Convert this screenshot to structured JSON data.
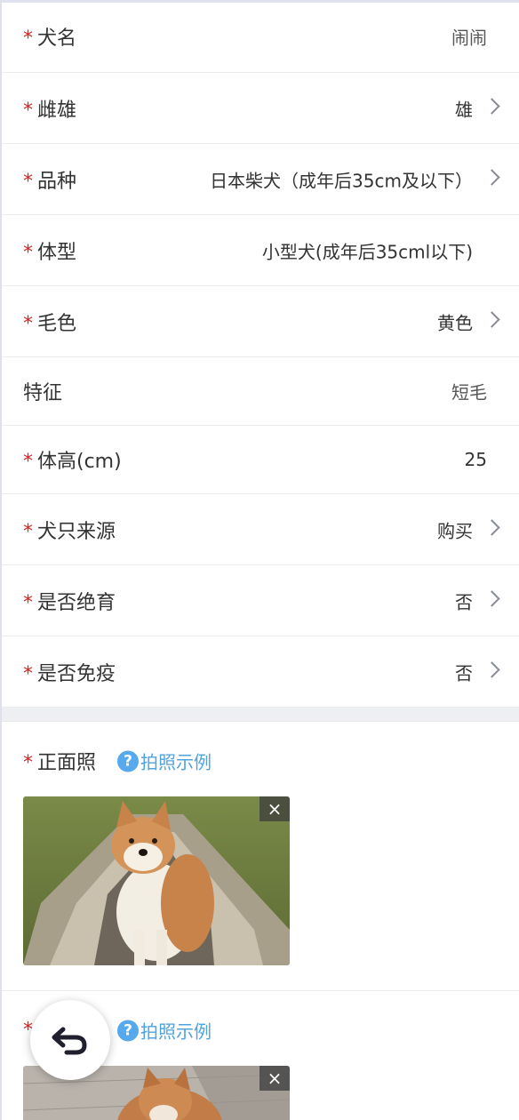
{
  "form": {
    "rows": [
      {
        "label": "犬名",
        "value": "闹闹",
        "required": true
      },
      {
        "label": "雌雄",
        "value": "雄",
        "required": true
      },
      {
        "label": "品种",
        "value": "日本柴犬（成年后35cm及以下）",
        "required": true
      },
      {
        "label": "体型",
        "value": "小型犬(成年后35cml以下)",
        "required": true
      },
      {
        "label": "毛色",
        "value": "黄色",
        "required": true
      },
      {
        "label": "特征",
        "value": "短毛",
        "required": false
      },
      {
        "label": "体高(cm)",
        "value": "25",
        "required": true
      },
      {
        "label": "犬只来源",
        "value": "购买",
        "required": true
      },
      {
        "label": "是否绝育",
        "value": "否",
        "required": true
      },
      {
        "label": "是否免疫",
        "value": "否",
        "required": true
      }
    ],
    "required_mark": "*"
  },
  "photos": {
    "front": {
      "label": "正面照",
      "example_link": "拍照示例",
      "help_icon": "?",
      "close_icon": "×"
    },
    "second": {
      "example_link": "拍照示例",
      "help_icon": "?",
      "close_icon": "×"
    }
  },
  "icons": {
    "chevron": "chevron-right-icon",
    "help": "question-circle-icon",
    "close": "close-icon",
    "back": "undo-back-icon"
  },
  "colors": {
    "required": "#e02020",
    "link": "#4fa3e0",
    "text": "#333333",
    "chevron": "#888c96"
  }
}
